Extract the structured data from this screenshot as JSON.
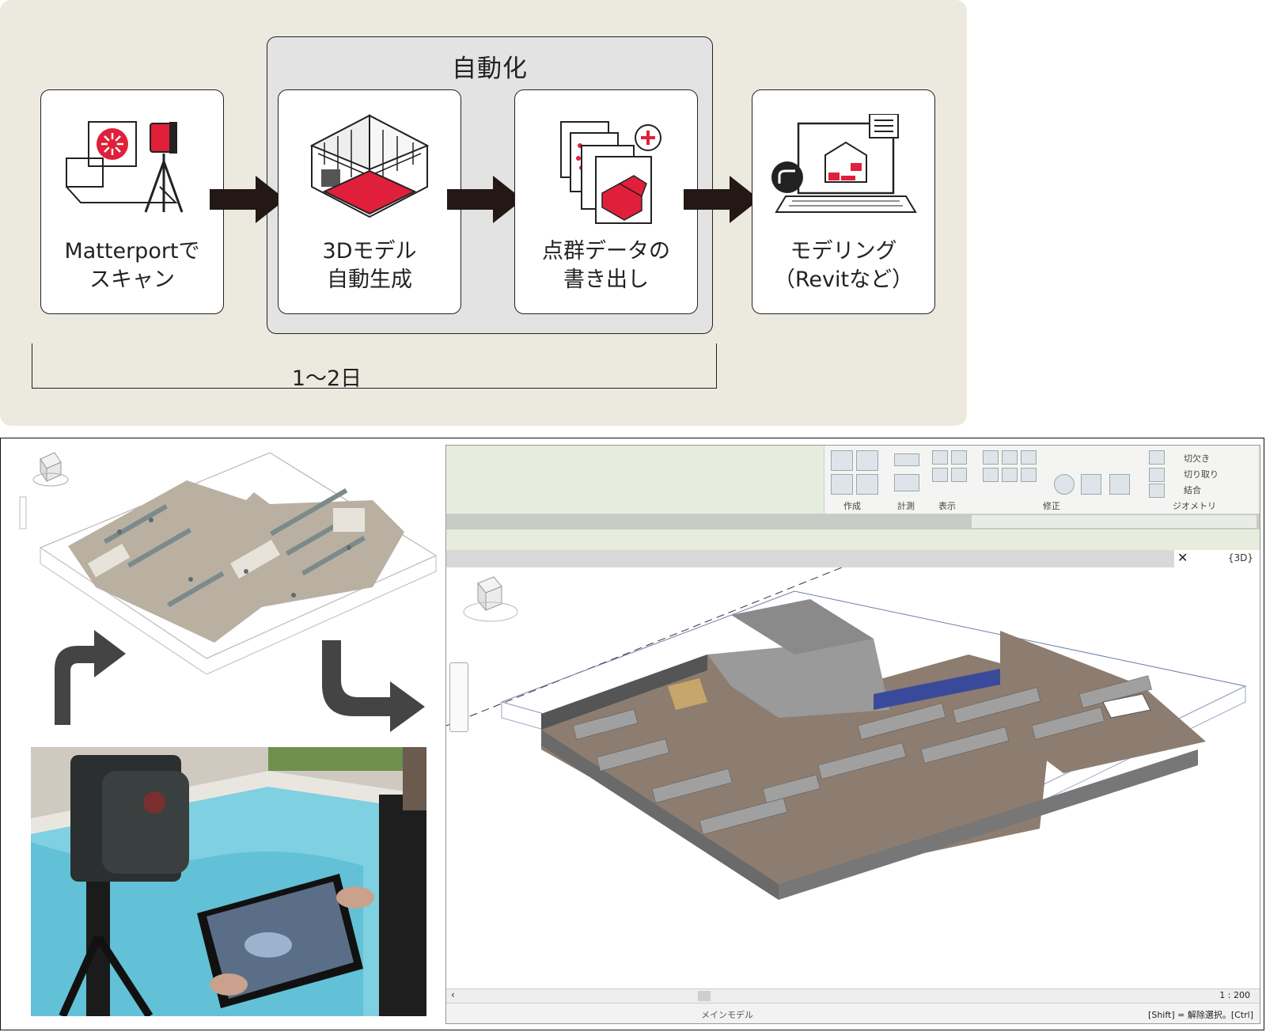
{
  "flow": {
    "auto_label": "自動化",
    "steps": [
      {
        "label": "Matterportで\nスキャン",
        "icon": "scanner-tripod-icon"
      },
      {
        "label": "3Dモデル\n自動生成",
        "icon": "isometric-room-icon"
      },
      {
        "label": "点群データの\n書き出し",
        "icon": "point-cloud-export-icon"
      },
      {
        "label": "モデリング\n（Revitなど）",
        "icon": "laptop-revit-icon"
      }
    ],
    "range_label": "1〜2日"
  },
  "colors": {
    "accent_red": "#e0203a",
    "panel_bg": "#eceadf",
    "group_bg": "#e3e3e3",
    "arrow": "#231815"
  },
  "revit": {
    "ribbon_groups": [
      "作成",
      "計測",
      "表示",
      "修正",
      "ジオメトリ"
    ],
    "ribbon_items": [
      "切り取り",
      "結合",
      "切欠き"
    ],
    "tab_name": "{3D}",
    "tab_close": "✕",
    "scale": "1 : 200",
    "status_message": "[Shift] = 解除選択。[Ctrl]",
    "model_label": "メインモデル"
  },
  "photo": {
    "subject": "Matterport camera on tripod with tablet"
  }
}
